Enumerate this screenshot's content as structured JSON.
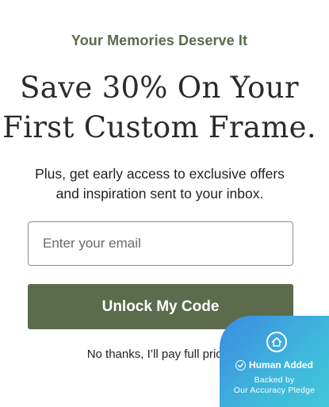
{
  "popup": {
    "eyebrow": "Your Memories Deserve It",
    "headline_line1": "Save 30% On Your",
    "headline_line2": "First Custom Frame.",
    "subtext_line1": "Plus, get early access to exclusive offers",
    "subtext_line2": "and inspiration sent to your inbox.",
    "email_placeholder": "Enter your email",
    "cta_label": "Unlock My Code",
    "decline_label": "No thanks, I’ll pay full price."
  },
  "badge": {
    "icon": "home-icon",
    "check_icon": "check-circle-icon",
    "title": "Human Added",
    "line1": "Backed by",
    "line2": "Our Accuracy Pledge"
  },
  "colors": {
    "accent": "#5b6b4b",
    "badge_start": "#3b8be0",
    "badge_end": "#43c7d8"
  }
}
